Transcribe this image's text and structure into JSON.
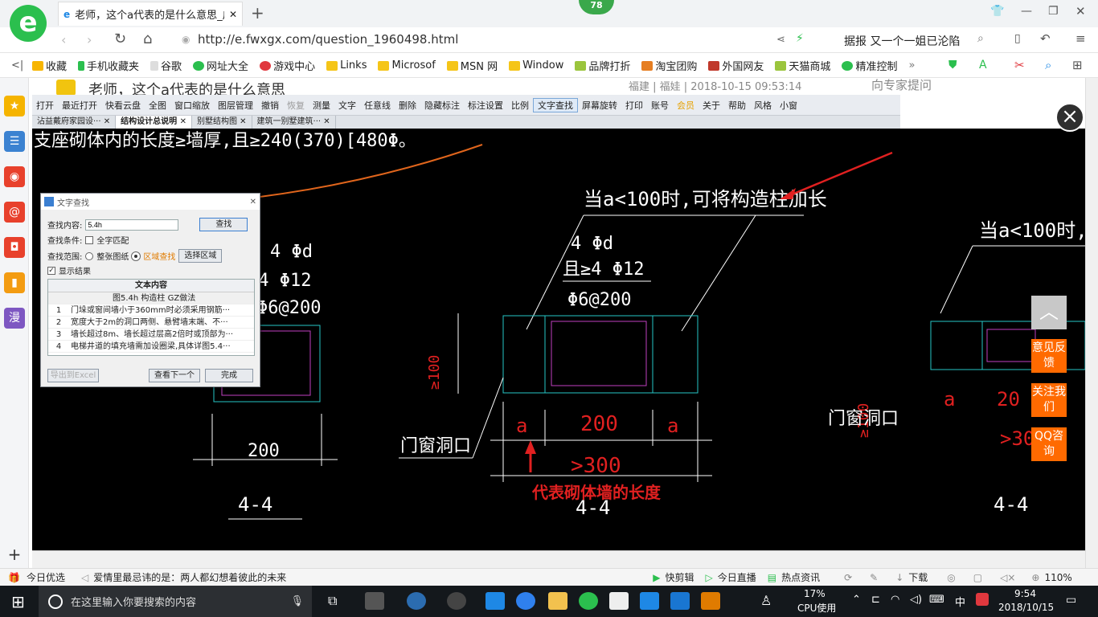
{
  "browser": {
    "tab_title": "老师，这个a代表的是什么意思_广",
    "badge": "78",
    "url": "http://e.fwxgx.com/question_1960498.html",
    "news_ticker": "据报 又一个一姐已沦陷",
    "bookmarks": [
      "收藏",
      "手机收藏夹",
      "谷歌",
      "网址大全",
      "游戏中心",
      "Links",
      "Microsof",
      "MSN 网",
      "Window",
      "品牌打折",
      "淘宝团购",
      "外国网友",
      "天猫商城",
      "精准控制"
    ]
  },
  "page": {
    "question_title": "老师，这个a代表的是什么意思",
    "question_meta": "福建 | 福娃 | 2018-10-15 09:53:14",
    "ask_expert": "向专家提问"
  },
  "cad": {
    "toolbar": [
      "打开",
      "最近打开",
      "快看云盘",
      "全图",
      "窗口缩放",
      "图层管理",
      "撤销",
      "恢复",
      "测量",
      "文字",
      "任意线",
      "删除",
      "隐藏标注",
      "标注设置",
      "比例",
      "文字查找",
      "屏幕旋转",
      "打印",
      "账号",
      "会员",
      "关于",
      "帮助",
      "风格",
      "小窗"
    ],
    "active_tool": "文字查找",
    "tabs": [
      "沾益戴府家园设···",
      "结构设计总说明",
      "别墅结构图",
      "建筑一别墅建筑···"
    ],
    "active_tab": "结构设计总说明",
    "drawing_texts": {
      "top_note": "支座砌体内的长度≥墙厚,且≥240(370)[480Φ。",
      "note_a": "当a<100时,可将构造柱加长",
      "note_a_right": "当a<100时,可将",
      "left_rebar1": "4 Φd",
      "left_rebar2": "≥4 Φ12",
      "left_rebar3": "Φ6@200",
      "mid_rebar1": "4 Φd",
      "mid_rebar2": "且≥4 Φ12",
      "mid_rebar3": "Φ6@200",
      "dim_200_left": "200",
      "dim_a1": "a",
      "dim_200": "200",
      "dim_a2": "a",
      "dim_300": ">300",
      "opening": "门窗洞口",
      "opening_right": "门窗洞口",
      "section": "4-4",
      "section_right": "4-4",
      "red_annotation": "代表砌体墙的长度",
      "dim_100": "≥100",
      "right_a": "a",
      "right_20": "20",
      "right_30": ">30"
    }
  },
  "find_dialog": {
    "title": "文字查找",
    "content_label": "查找内容:",
    "content_value": "5.4h",
    "find_button": "查找",
    "cond_label": "查找条件:",
    "whole_word": "全字匹配",
    "range_label": "查找范围:",
    "range_all": "整张图纸",
    "range_area": "区域查找",
    "select_area_button": "选择区域",
    "show_results": "显示结果",
    "results_header": "文本内容",
    "results": [
      {
        "n": "",
        "t": "图5.4h 构造柱 GZ做法"
      },
      {
        "n": "1",
        "t": "门垛或窗间墙小于360mm时必须采用钢筋···"
      },
      {
        "n": "2",
        "t": "宽度大于2m的洞口两侧、悬臂墙末端、不···"
      },
      {
        "n": "3",
        "t": "墙长超过8m、墙长超过层高2倍时或顶部为···"
      },
      {
        "n": "4",
        "t": "电梯井道的填充墙需加设圈梁,具体详图5.4···"
      }
    ],
    "export_button": "导出到Excel",
    "next_button": "查看下一个",
    "done_button": "完成"
  },
  "right_float": [
    "意见反馈",
    "关注我们",
    "QQ咨询"
  ],
  "statusbar": {
    "left": "今日优选",
    "ticker": "爱情里最忌讳的是：两人都幻想着彼此的未来",
    "items": [
      "快剪辑",
      "今日直播",
      "热点资讯",
      "下载"
    ],
    "zoom": "110%"
  },
  "taskbar": {
    "search_placeholder": "在这里输入你要搜索的内容",
    "cpu_percent": "17%",
    "cpu_label": "CPU使用",
    "ime": "中",
    "time": "9:54",
    "date": "2018/10/15"
  }
}
